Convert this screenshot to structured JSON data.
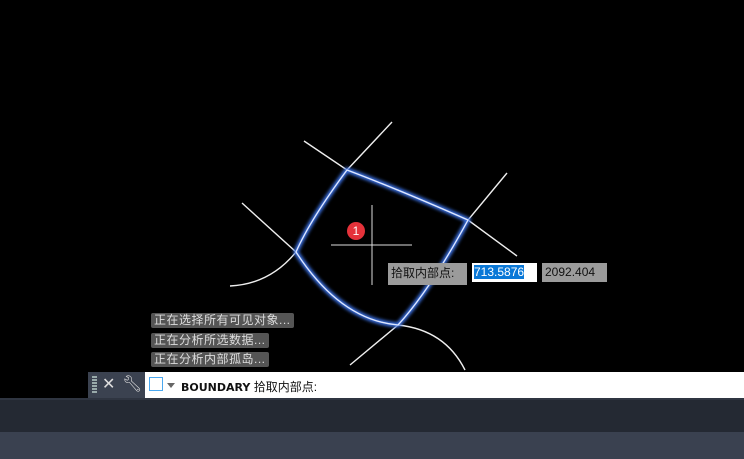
{
  "drawing": {
    "marker_number": "1",
    "boundary_color": "#4a7fe0"
  },
  "tooltip": {
    "label": "拾取内部点:",
    "x_value": "713.5876",
    "y_value": "2092.404"
  },
  "messages": [
    "正在选择所有可见对象...",
    "正在分析所选数据...",
    "正在分析内部孤岛..."
  ],
  "command_line": {
    "command": "BOUNDARY",
    "prompt": "拾取内部点:"
  }
}
